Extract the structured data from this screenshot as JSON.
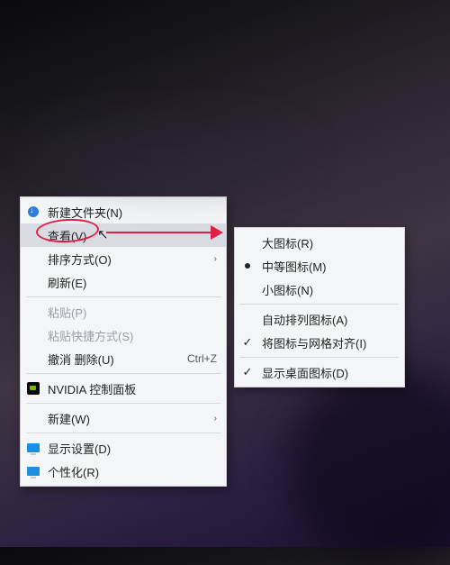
{
  "main_menu": {
    "items": [
      {
        "label": "新建文件夹(N)",
        "icon": "new"
      },
      {
        "label": "查看(V)",
        "submenu": true,
        "hover": true
      },
      {
        "label": "排序方式(O)",
        "submenu": true
      },
      {
        "label": "刷新(E)"
      },
      {
        "sep": true
      },
      {
        "label": "粘贴(P)",
        "disabled": true
      },
      {
        "label": "粘贴快捷方式(S)",
        "disabled": true
      },
      {
        "label": "撤消 删除(U)",
        "accel": "Ctrl+Z"
      },
      {
        "sep": true
      },
      {
        "label": "NVIDIA 控制面板",
        "icon": "nvidia"
      },
      {
        "sep": true
      },
      {
        "label": "新建(W)",
        "submenu": true
      },
      {
        "sep": true
      },
      {
        "label": "显示设置(D)",
        "icon": "monitor"
      },
      {
        "label": "个性化(R)",
        "icon": "monitor"
      }
    ]
  },
  "sub_menu": {
    "items": [
      {
        "label": "大图标(R)"
      },
      {
        "label": "中等图标(M)",
        "mark": "bullet"
      },
      {
        "label": "小图标(N)"
      },
      {
        "sep": true
      },
      {
        "label": "自动排列图标(A)"
      },
      {
        "label": "将图标与网格对齐(I)",
        "mark": "check"
      },
      {
        "sep": true
      },
      {
        "label": "显示桌面图标(D)",
        "mark": "check"
      }
    ]
  },
  "annotation": {
    "color": "#e02046"
  },
  "glyphs": {
    "arrow": "›",
    "check": "✓"
  }
}
